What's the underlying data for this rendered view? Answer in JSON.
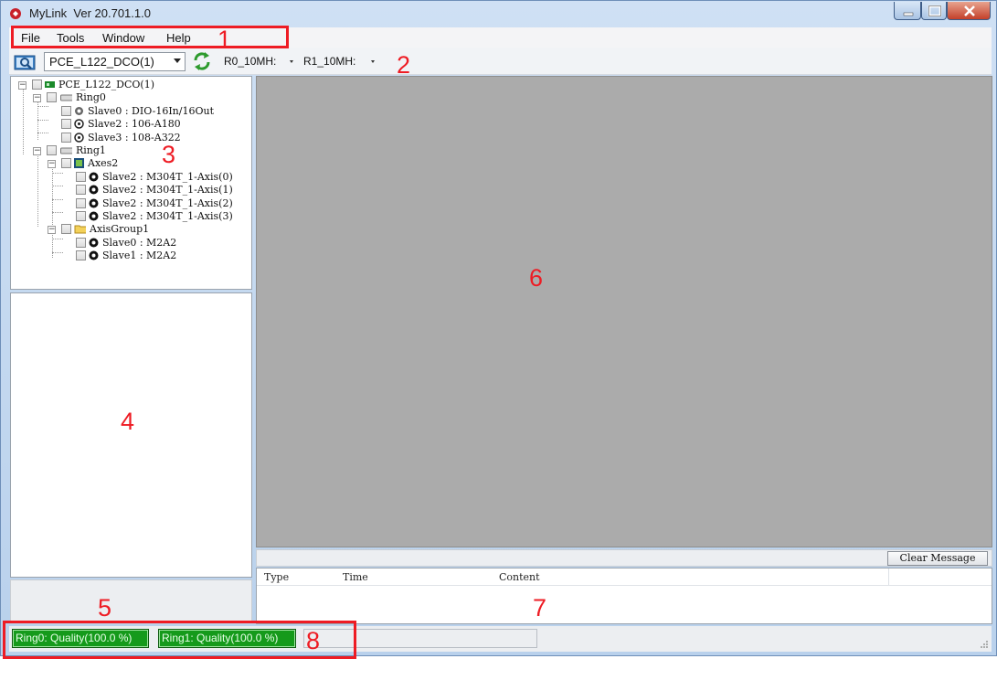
{
  "window": {
    "title": "MyLink  Ver 20.701.1.0"
  },
  "menu": [
    "File",
    "Tools",
    "Window",
    "Help"
  ],
  "toolbar": {
    "device_selected": "PCE_L122_DCO(1)",
    "ring0_speed": "R0_10MH:",
    "ring1_speed": "R1_10MH:"
  },
  "tree": [
    {
      "label": "PCE_L122_DCO(1)",
      "icon": "card-icon",
      "level": 0,
      "expander": "-"
    },
    {
      "label": "Ring0",
      "icon": "ring-icon",
      "level": 1,
      "expander": "-"
    },
    {
      "label": "Slave0 : DIO-16In/16Out",
      "icon": "io-module-icon",
      "level": 2
    },
    {
      "label": "Slave2 : 106-A180",
      "icon": "encoder-icon",
      "level": 2
    },
    {
      "label": "Slave3 : 108-A322",
      "icon": "encoder-icon",
      "level": 2
    },
    {
      "label": "Ring1",
      "icon": "ring-icon",
      "level": 1,
      "expander": "-"
    },
    {
      "label": "Axes2",
      "icon": "axes-icon",
      "level": 2,
      "expander": "-"
    },
    {
      "label": "Slave2 : M304T_1-Axis(0)",
      "icon": "motor-icon",
      "level": 3
    },
    {
      "label": "Slave2 : M304T_1-Axis(1)",
      "icon": "motor-icon",
      "level": 3
    },
    {
      "label": "Slave2 : M304T_1-Axis(2)",
      "icon": "motor-icon",
      "level": 3
    },
    {
      "label": "Slave2 : M304T_1-Axis(3)",
      "icon": "motor-icon",
      "level": 3
    },
    {
      "label": "AxisGroup1",
      "icon": "folder-icon",
      "level": 2,
      "expander": "-"
    },
    {
      "label": "Slave0 : M2A2",
      "icon": "motor-icon",
      "level": 3
    },
    {
      "label": "Slave1 : M2A2",
      "icon": "motor-icon",
      "level": 3
    }
  ],
  "messages": {
    "clear_label": "Clear Message",
    "columns": [
      "Type",
      "Time",
      "Content"
    ]
  },
  "status": {
    "ring0_quality": "Ring0: Quality(100.0 %)",
    "ring1_quality": "Ring1: Quality(100.0 %)"
  },
  "callouts": [
    "1",
    "2",
    "3",
    "4",
    "5",
    "6",
    "7",
    "8"
  ],
  "colors": {
    "callout": "#ee1c24",
    "quality_ok": "#159a1b",
    "workspace": "#ababab"
  }
}
